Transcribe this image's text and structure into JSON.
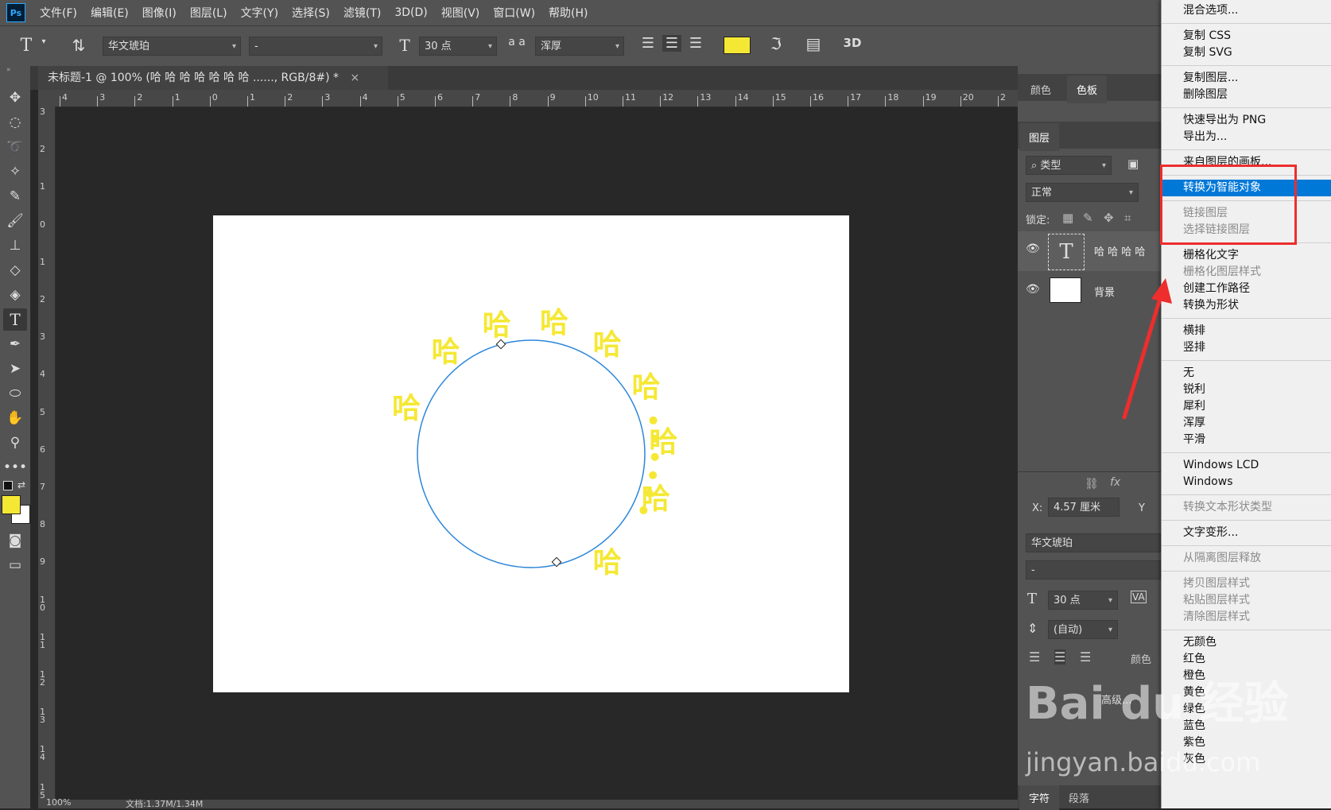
{
  "menubar": {
    "logo": "Ps",
    "items": [
      "文件(F)",
      "编辑(E)",
      "图像(I)",
      "图层(L)",
      "文字(Y)",
      "选择(S)",
      "滤镜(T)",
      "3D(D)",
      "视图(V)",
      "窗口(W)",
      "帮助(H)"
    ]
  },
  "options": {
    "font_family": "华文琥珀",
    "font_style": "-",
    "font_size": "30 点",
    "antialias": "浑厚",
    "aa_icon_label": "a a",
    "three_d": "3D",
    "text_color": "#f5e834"
  },
  "document": {
    "tab_title": "未标题-1 @ 100% (哈 哈 哈 哈 哈 哈 哈 ......, RGB/8#) *",
    "close": "×",
    "hruler_labels": [
      "4",
      "3",
      "2",
      "1",
      "0",
      "1",
      "2",
      "3",
      "4",
      "5",
      "6",
      "7",
      "8",
      "9",
      "10",
      "11",
      "12",
      "13",
      "14",
      "15",
      "16",
      "17",
      "18",
      "19",
      "20",
      "2"
    ],
    "vruler_labels": [
      "3",
      "2",
      "1",
      "0",
      "1",
      "2",
      "3",
      "4",
      "5",
      "6",
      "7",
      "8",
      "9",
      "10",
      "11",
      "12",
      "13",
      "14",
      "15"
    ],
    "status_zoom": "100%",
    "status_doc": "文档:1.37M/1.34M",
    "circle_text_char": "哈"
  },
  "panels": {
    "top_tabs": [
      "颜色",
      "色板"
    ],
    "layers_tab": "图层",
    "filter_kind": "类型",
    "blend_mode": "正常",
    "lock_label": "锁定:",
    "layers": [
      {
        "name": "哈 哈 哈 哈",
        "thumb": "T"
      },
      {
        "name": "背景",
        "thumb": ""
      }
    ],
    "fx": "fx",
    "x_label": "X:",
    "x_value": "4.57 厘米",
    "y_label": "Y",
    "char_font": "华文琥珀",
    "char_style": "-",
    "char_size": "30 点",
    "char_leading": "(自动)",
    "va_label": "VA",
    "advanced": "高级...",
    "bottom_tabs": [
      "字符",
      "段落"
    ],
    "color_label": "颜色"
  },
  "context_menu": {
    "items": [
      {
        "label": "混合选项...",
        "disabled": false
      },
      {
        "label": "复制 CSS",
        "disabled": false
      },
      {
        "label": "复制 SVG",
        "disabled": false
      },
      {
        "label": "复制图层...",
        "disabled": false
      },
      {
        "label": "删除图层",
        "disabled": false
      },
      {
        "label": "快速导出为 PNG",
        "disabled": false
      },
      {
        "label": "导出为...",
        "disabled": false
      },
      {
        "label": "来自图层的画板...",
        "disabled": false
      },
      {
        "label": "转换为智能对象",
        "disabled": false,
        "highlighted": true
      },
      {
        "label": "链接图层",
        "disabled": true
      },
      {
        "label": "选择链接图层",
        "disabled": true
      },
      {
        "label": "栅格化文字",
        "disabled": false
      },
      {
        "label": "栅格化图层样式",
        "disabled": true
      },
      {
        "label": "创建工作路径",
        "disabled": false
      },
      {
        "label": "转换为形状",
        "disabled": false
      },
      {
        "label": "横排",
        "disabled": false
      },
      {
        "label": "竖排",
        "disabled": false
      },
      {
        "label": "无",
        "disabled": false
      },
      {
        "label": "锐利",
        "disabled": false
      },
      {
        "label": "犀利",
        "disabled": false
      },
      {
        "label": "浑厚",
        "disabled": false
      },
      {
        "label": "平滑",
        "disabled": false
      },
      {
        "label": "Windows LCD",
        "disabled": false
      },
      {
        "label": "Windows",
        "disabled": false
      },
      {
        "label": "转换文本形状类型",
        "disabled": true
      },
      {
        "label": "文字变形...",
        "disabled": false
      },
      {
        "label": "从隔离图层释放",
        "disabled": true
      },
      {
        "label": "拷贝图层样式",
        "disabled": true
      },
      {
        "label": "粘贴图层样式",
        "disabled": true
      },
      {
        "label": "清除图层样式",
        "disabled": true
      },
      {
        "label": "无颜色",
        "disabled": false
      },
      {
        "label": "红色",
        "disabled": false
      },
      {
        "label": "橙色",
        "disabled": false
      },
      {
        "label": "黄色",
        "disabled": false
      },
      {
        "label": "绿色",
        "disabled": false
      },
      {
        "label": "蓝色",
        "disabled": false
      },
      {
        "label": "紫色",
        "disabled": false
      },
      {
        "label": "灰色",
        "disabled": false
      }
    ]
  },
  "watermark": {
    "logo": "Bai du 经验",
    "url": "jingyan.baidu.com"
  }
}
